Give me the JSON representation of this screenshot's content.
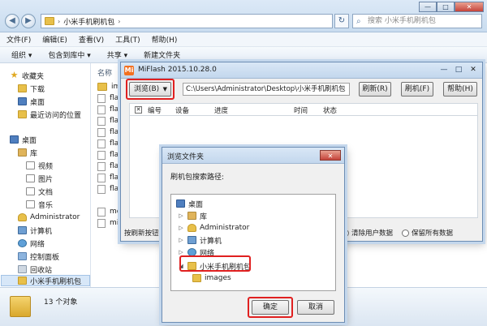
{
  "explorer": {
    "breadcrumb": "小米手机刷机包",
    "search_placeholder": "搜索 小米手机刷机包",
    "menu": [
      "文件(F)",
      "编辑(E)",
      "查看(V)",
      "工具(T)",
      "帮助(H)"
    ],
    "toolbar": [
      "组织 ▾",
      "包含到库中 ▾",
      "共享 ▾",
      "新建文件夹"
    ],
    "nav": {
      "favorites": "收藏夹",
      "downloads": "下载",
      "desktop_fav": "桌面",
      "recent": "最近访问的位置",
      "desktop": "桌面",
      "libraries": "库",
      "videos": "视频",
      "pictures": "图片",
      "documents": "文档",
      "music": "音乐",
      "admin": "Administrator",
      "computer": "计算机",
      "network": "网络",
      "control_panel": "控制面板",
      "recycle_bin": "回收站",
      "current": "小米手机刷机包"
    },
    "column_name": "名称",
    "files": [
      "ima",
      "flas",
      "flas",
      "flas",
      "flas",
      "flas",
      "flas",
      "flas",
      "flas",
      "flas",
      "md",
      "mis"
    ],
    "status_count": "13 个对象"
  },
  "miflash": {
    "title": "MiFlash 2015.10.28.0",
    "logo": "Mi",
    "browse_button": "浏览(B)",
    "path": "C:\\Users\\Administrator\\Desktop\\小米手机刷机包",
    "refresh_button": "刷新(R)",
    "flash_button": "刷机(F)",
    "help_button": "帮助(H)",
    "columns": [
      "编号",
      "设备",
      "进度",
      "时间",
      "状态"
    ],
    "hint": "按刷新按钮",
    "radio_options": [
      {
        "label": "清除用户数据",
        "selected": true
      },
      {
        "label": "保留所有数据",
        "selected": false
      }
    ]
  },
  "browse_dialog": {
    "title": "浏览文件夹",
    "prompt": "刷机包搜索路径:",
    "tree": [
      "桌面",
      "库",
      "Administrator",
      "计算机",
      "网络",
      "小米手机刷机包",
      "images"
    ],
    "ok_button": "确定",
    "cancel_button": "取消"
  },
  "colors": {
    "highlight_red": "#e02020",
    "title_blue": "#c3d7ed",
    "mi_orange": "#f37021"
  }
}
